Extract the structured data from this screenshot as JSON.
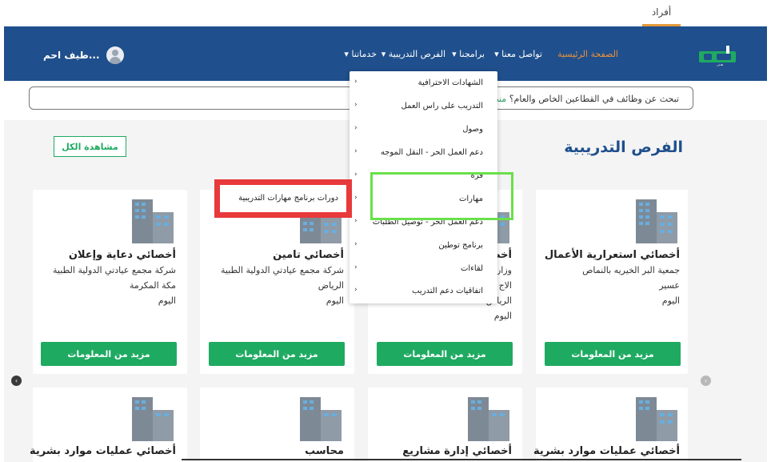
{
  "top_tab": {
    "label": "أفراد"
  },
  "logo": {
    "text": "هدف",
    "colors": {
      "green": "#1faa62",
      "white": "#ffffff"
    }
  },
  "nav": {
    "items": [
      {
        "label": "الصفحة الرئيسية",
        "active": true
      },
      {
        "label": "تواصل معنا ▾"
      },
      {
        "label": "برامجنا ▾"
      },
      {
        "label": "الفرص التدريبية ▾"
      },
      {
        "label": "خدماتنا ▾"
      }
    ],
    "user_name": "طيف احم..."
  },
  "search": {
    "text_before": "تبحث عن وظائف في القطاعين الخاص والعام؟",
    "brand": "منصة"
  },
  "section": {
    "title": "الفرص التدريبية",
    "view_all": "مشاهدة الكل"
  },
  "dropdown": {
    "items": [
      {
        "label": "الشهادات الاحترافية",
        "chevron": "‹"
      },
      {
        "label": "التدريب على راس العمل",
        "chevron": "‹"
      },
      {
        "label": "وصول",
        "chevron": "‹"
      },
      {
        "label": "دعم العمل الحر - النقل الموجه",
        "chevron": "‹"
      },
      {
        "label": "قرة",
        "chevron": "‹"
      },
      {
        "label": "مهارات",
        "chevron": "‹"
      },
      {
        "label": "دعم العمل الحر - توصيل الطلبات",
        "chevron": "‹"
      },
      {
        "label": "برنامج توطين",
        "chevron": "‹"
      },
      {
        "label": "لقاءات",
        "chevron": "‹"
      },
      {
        "label": "اتفاقيات دعم التدريب",
        "chevron": "‹"
      }
    ]
  },
  "submenu": {
    "label": "دورات برنامج مهارات التدريبية"
  },
  "cards_top": [
    {
      "title": "أخصائي استعرارية الأعمال",
      "lines": [
        "جمعية البر الخيريه بالنماص",
        "عسير",
        "اليوم"
      ],
      "button": "مزيد من المعلومات"
    },
    {
      "title": "أخص",
      "lines": [
        "وزارة",
        "الاج",
        "الرياض",
        "اليوم"
      ],
      "button": "مزيد من المعلومات"
    },
    {
      "title": "أخصائي تامين",
      "lines": [
        "شركة مجمع عيادتي الدولية الطبية",
        "الرياض",
        "اليوم"
      ],
      "button": "مزيد من المعلومات"
    },
    {
      "title": "أخصائي دعاية وإعلان",
      "lines": [
        "شركة مجمع عيادتي الدولية الطبية",
        "مكة المكرمة",
        "اليوم"
      ],
      "button": "مزيد من المعلومات"
    }
  ],
  "cards_bottom": [
    {
      "title": "أخصائي عمليات موارد بشرية"
    },
    {
      "title": "أخصائي إدارة مشاريع"
    },
    {
      "title": "محاسب"
    },
    {
      "title": "أخصائي عمليات موارد بشرية"
    }
  ],
  "carousel": {
    "prev_icon": "‹",
    "next_icon": "›"
  },
  "colors": {
    "nav": "#1f4f8c",
    "accent": "#e8903b",
    "green": "#1faa62",
    "highlight_red": "#e8393b",
    "highlight_green": "#69e04a"
  }
}
